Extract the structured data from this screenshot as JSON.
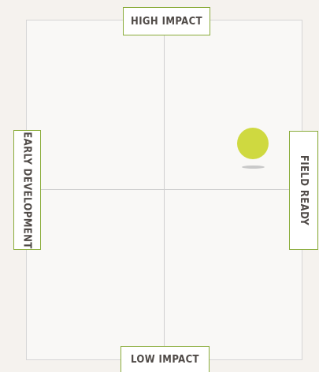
{
  "labels": {
    "top": "HIGH IMPACT",
    "bottom": "LOW IMPACT",
    "left": "EARLY DEVELOPMENT",
    "right": "FIELD READY"
  },
  "colors": {
    "background": "#f5f2ee",
    "label_border": "#8aac3a",
    "point": "#cfd940",
    "gridline": "#cfcfcf"
  },
  "point": {
    "readiness": 0.77,
    "impact": 0.58
  }
}
